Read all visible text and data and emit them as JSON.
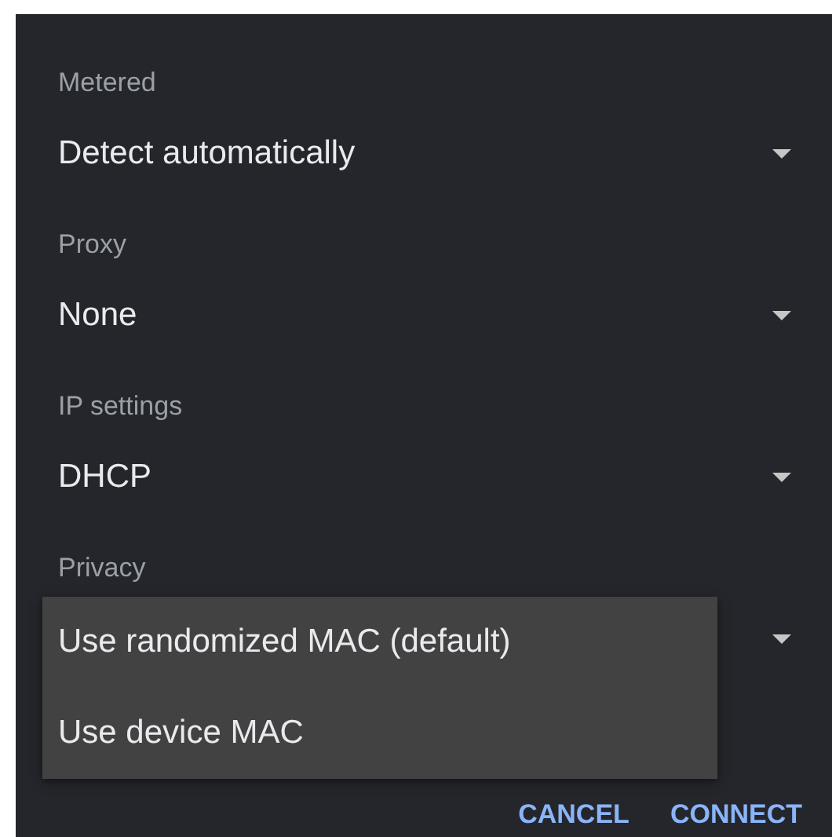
{
  "fields": [
    {
      "label": "Metered",
      "value": "Detect automatically"
    },
    {
      "label": "Proxy",
      "value": "None"
    },
    {
      "label": "IP settings",
      "value": "DHCP"
    },
    {
      "label": "Privacy"
    }
  ],
  "menu": {
    "items": [
      "Use randomized MAC (default)",
      "Use device MAC"
    ]
  },
  "buttons": [
    "CANCEL",
    "CONNECT"
  ]
}
